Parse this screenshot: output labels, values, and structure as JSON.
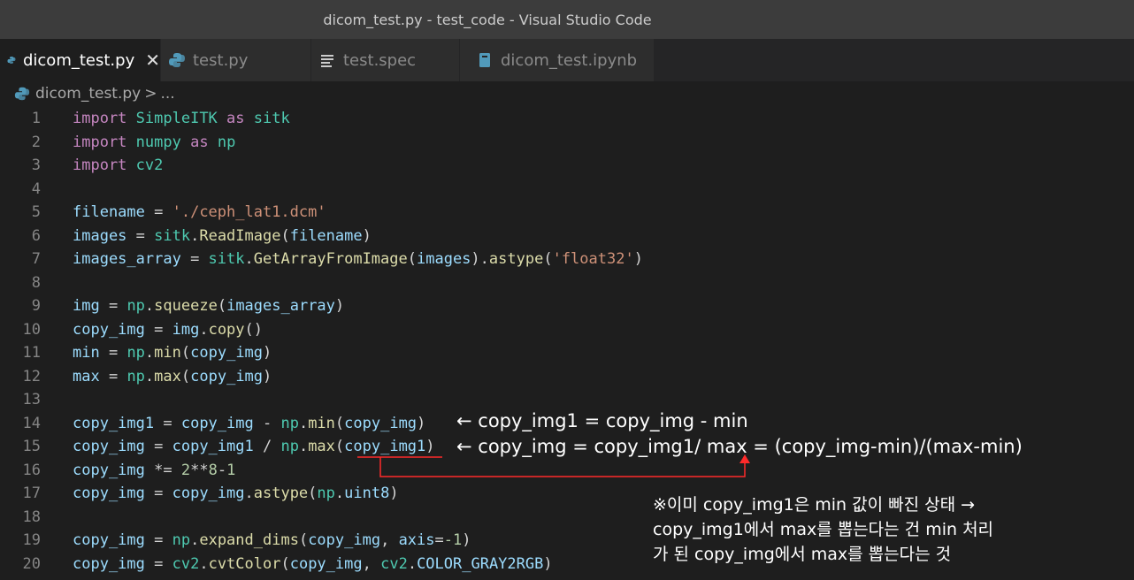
{
  "window": {
    "title": "dicom_test.py - test_code - Visual Studio Code"
  },
  "tabs": [
    {
      "label": "dicom_test.py",
      "icon": "python-icon",
      "active": true,
      "close": "✕"
    },
    {
      "label": "test.py",
      "icon": "python-icon",
      "active": false
    },
    {
      "label": "test.spec",
      "icon": "text-file-icon",
      "active": false
    },
    {
      "label": "dicom_test.ipynb",
      "icon": "notebook-icon",
      "active": false
    }
  ],
  "breadcrumb": {
    "file": "dicom_test.py",
    "sep": ">",
    "rest": "..."
  },
  "line_numbers": [
    "1",
    "2",
    "3",
    "4",
    "5",
    "6",
    "7",
    "8",
    "9",
    "10",
    "11",
    "12",
    "13",
    "14",
    "15",
    "16",
    "17",
    "18",
    "19",
    "20"
  ],
  "code_tokens": {
    "l1": [
      "import",
      " ",
      "SimpleITK",
      " ",
      "as",
      " ",
      "sitk"
    ],
    "l2": [
      "import",
      " ",
      "numpy",
      " ",
      "as",
      " ",
      "np"
    ],
    "l3": [
      "import",
      " ",
      "cv2"
    ],
    "l5": [
      "filename",
      " = ",
      "'./ceph_lat1.dcm'"
    ],
    "l6": [
      "images",
      " = ",
      "sitk",
      ".",
      "ReadImage",
      "(",
      "filename",
      ")"
    ],
    "l7": [
      "images_array",
      " = ",
      "sitk",
      ".",
      "GetArrayFromImage",
      "(",
      "images",
      ").",
      "astype",
      "(",
      "'float32'",
      ")"
    ],
    "l9": [
      "img",
      " = ",
      "np",
      ".",
      "squeeze",
      "(",
      "images_array",
      ")"
    ],
    "l10": [
      "copy_img",
      " = ",
      "img",
      ".",
      "copy",
      "()"
    ],
    "l11": [
      "min",
      " = ",
      "np",
      ".",
      "min",
      "(",
      "copy_img",
      ")"
    ],
    "l12": [
      "max",
      " = ",
      "np",
      ".",
      "max",
      "(",
      "copy_img",
      ")"
    ],
    "l14": [
      "copy_img1",
      " = ",
      "copy_img",
      " - ",
      "np",
      ".",
      "min",
      "(",
      "copy_img",
      ")"
    ],
    "l15": [
      "copy_img",
      " = ",
      "copy_img1",
      " / ",
      "np",
      ".",
      "max",
      "(",
      "copy_img1",
      ")"
    ],
    "l16": [
      "copy_img",
      " *= ",
      "2",
      "**",
      "8",
      "-",
      "1"
    ],
    "l17": [
      "copy_img",
      " = ",
      "copy_img",
      ".",
      "astype",
      "(",
      "np",
      ".",
      "uint8",
      ")"
    ],
    "l19": [
      "copy_img",
      " = ",
      "np",
      ".",
      "expand_dims",
      "(",
      "copy_img",
      ", ",
      "axis",
      "=",
      "-1",
      ")"
    ],
    "l20": [
      "copy_img",
      " = ",
      "cv2",
      ".",
      "cvtColor",
      "(",
      "copy_img",
      ", ",
      "cv2",
      ".",
      "COLOR_GRAY2RGB",
      ")"
    ]
  },
  "annotations": {
    "a1": "← copy_img1 = copy_img - min",
    "a2": "← copy_img = copy_img1/ max = (copy_img-min)/(max-min)",
    "note1": "※이미 copy_img1은 min 값이 빠진 상태 →",
    "note2": "copy_img1에서 max를 뽑는다는 건 min 처리",
    "note3": "가 된 copy_img에서 max를 뽑는다는 것"
  },
  "colors": {
    "keyword": "#c586c0",
    "module": "#4ec9b0",
    "variable": "#9cdcfe",
    "function": "#dcdcaa",
    "string": "#ce9178",
    "number": "#b5cea8",
    "annotation_line": "#ff2a2a"
  }
}
